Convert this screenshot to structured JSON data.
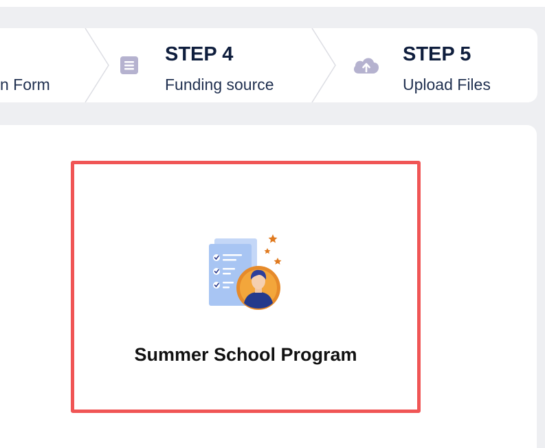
{
  "steps": [
    {
      "label": "n Form"
    },
    {
      "number": "STEP 4",
      "label": "Funding source",
      "icon": "form-icon"
    },
    {
      "number": "STEP 5",
      "label": "Upload Files",
      "icon": "cloud-upload-icon"
    }
  ],
  "program_card": {
    "title": "Summer School Program",
    "icon": "checklist-student-icon",
    "selected_border_color": "#f05555"
  },
  "colors": {
    "step_title": "#0f1e3d",
    "step_icon": "#b5b2cf"
  }
}
